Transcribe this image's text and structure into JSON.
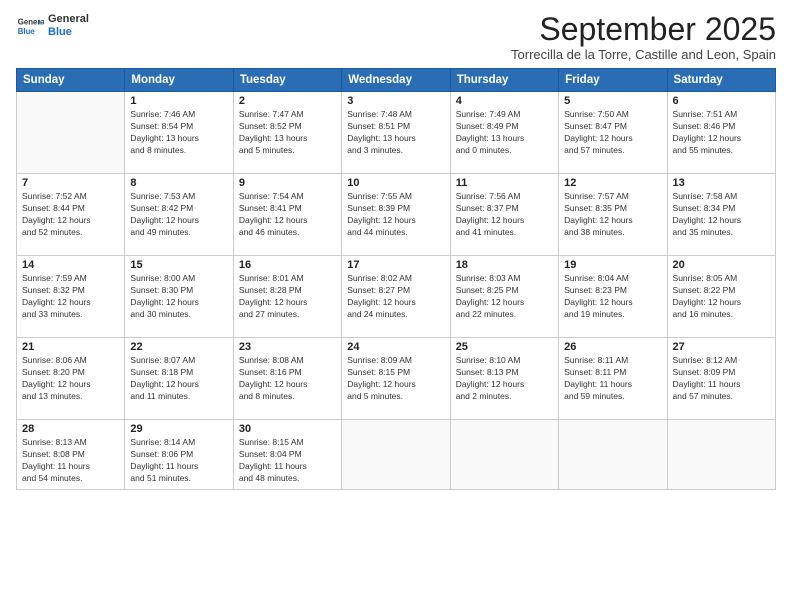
{
  "header": {
    "logo_line1": "General",
    "logo_line2": "Blue",
    "title": "September 2025",
    "subtitle": "Torrecilla de la Torre, Castille and Leon, Spain"
  },
  "weekdays": [
    "Sunday",
    "Monday",
    "Tuesday",
    "Wednesday",
    "Thursday",
    "Friday",
    "Saturday"
  ],
  "weeks": [
    [
      {
        "day": "",
        "info": ""
      },
      {
        "day": "1",
        "info": "Sunrise: 7:46 AM\nSunset: 8:54 PM\nDaylight: 13 hours\nand 8 minutes."
      },
      {
        "day": "2",
        "info": "Sunrise: 7:47 AM\nSunset: 8:52 PM\nDaylight: 13 hours\nand 5 minutes."
      },
      {
        "day": "3",
        "info": "Sunrise: 7:48 AM\nSunset: 8:51 PM\nDaylight: 13 hours\nand 3 minutes."
      },
      {
        "day": "4",
        "info": "Sunrise: 7:49 AM\nSunset: 8:49 PM\nDaylight: 13 hours\nand 0 minutes."
      },
      {
        "day": "5",
        "info": "Sunrise: 7:50 AM\nSunset: 8:47 PM\nDaylight: 12 hours\nand 57 minutes."
      },
      {
        "day": "6",
        "info": "Sunrise: 7:51 AM\nSunset: 8:46 PM\nDaylight: 12 hours\nand 55 minutes."
      }
    ],
    [
      {
        "day": "7",
        "info": "Sunrise: 7:52 AM\nSunset: 8:44 PM\nDaylight: 12 hours\nand 52 minutes."
      },
      {
        "day": "8",
        "info": "Sunrise: 7:53 AM\nSunset: 8:42 PM\nDaylight: 12 hours\nand 49 minutes."
      },
      {
        "day": "9",
        "info": "Sunrise: 7:54 AM\nSunset: 8:41 PM\nDaylight: 12 hours\nand 46 minutes."
      },
      {
        "day": "10",
        "info": "Sunrise: 7:55 AM\nSunset: 8:39 PM\nDaylight: 12 hours\nand 44 minutes."
      },
      {
        "day": "11",
        "info": "Sunrise: 7:56 AM\nSunset: 8:37 PM\nDaylight: 12 hours\nand 41 minutes."
      },
      {
        "day": "12",
        "info": "Sunrise: 7:57 AM\nSunset: 8:35 PM\nDaylight: 12 hours\nand 38 minutes."
      },
      {
        "day": "13",
        "info": "Sunrise: 7:58 AM\nSunset: 8:34 PM\nDaylight: 12 hours\nand 35 minutes."
      }
    ],
    [
      {
        "day": "14",
        "info": "Sunrise: 7:59 AM\nSunset: 8:32 PM\nDaylight: 12 hours\nand 33 minutes."
      },
      {
        "day": "15",
        "info": "Sunrise: 8:00 AM\nSunset: 8:30 PM\nDaylight: 12 hours\nand 30 minutes."
      },
      {
        "day": "16",
        "info": "Sunrise: 8:01 AM\nSunset: 8:28 PM\nDaylight: 12 hours\nand 27 minutes."
      },
      {
        "day": "17",
        "info": "Sunrise: 8:02 AM\nSunset: 8:27 PM\nDaylight: 12 hours\nand 24 minutes."
      },
      {
        "day": "18",
        "info": "Sunrise: 8:03 AM\nSunset: 8:25 PM\nDaylight: 12 hours\nand 22 minutes."
      },
      {
        "day": "19",
        "info": "Sunrise: 8:04 AM\nSunset: 8:23 PM\nDaylight: 12 hours\nand 19 minutes."
      },
      {
        "day": "20",
        "info": "Sunrise: 8:05 AM\nSunset: 8:22 PM\nDaylight: 12 hours\nand 16 minutes."
      }
    ],
    [
      {
        "day": "21",
        "info": "Sunrise: 8:06 AM\nSunset: 8:20 PM\nDaylight: 12 hours\nand 13 minutes."
      },
      {
        "day": "22",
        "info": "Sunrise: 8:07 AM\nSunset: 8:18 PM\nDaylight: 12 hours\nand 11 minutes."
      },
      {
        "day": "23",
        "info": "Sunrise: 8:08 AM\nSunset: 8:16 PM\nDaylight: 12 hours\nand 8 minutes."
      },
      {
        "day": "24",
        "info": "Sunrise: 8:09 AM\nSunset: 8:15 PM\nDaylight: 12 hours\nand 5 minutes."
      },
      {
        "day": "25",
        "info": "Sunrise: 8:10 AM\nSunset: 8:13 PM\nDaylight: 12 hours\nand 2 minutes."
      },
      {
        "day": "26",
        "info": "Sunrise: 8:11 AM\nSunset: 8:11 PM\nDaylight: 11 hours\nand 59 minutes."
      },
      {
        "day": "27",
        "info": "Sunrise: 8:12 AM\nSunset: 8:09 PM\nDaylight: 11 hours\nand 57 minutes."
      }
    ],
    [
      {
        "day": "28",
        "info": "Sunrise: 8:13 AM\nSunset: 8:08 PM\nDaylight: 11 hours\nand 54 minutes."
      },
      {
        "day": "29",
        "info": "Sunrise: 8:14 AM\nSunset: 8:06 PM\nDaylight: 11 hours\nand 51 minutes."
      },
      {
        "day": "30",
        "info": "Sunrise: 8:15 AM\nSunset: 8:04 PM\nDaylight: 11 hours\nand 48 minutes."
      },
      {
        "day": "",
        "info": ""
      },
      {
        "day": "",
        "info": ""
      },
      {
        "day": "",
        "info": ""
      },
      {
        "day": "",
        "info": ""
      }
    ]
  ]
}
